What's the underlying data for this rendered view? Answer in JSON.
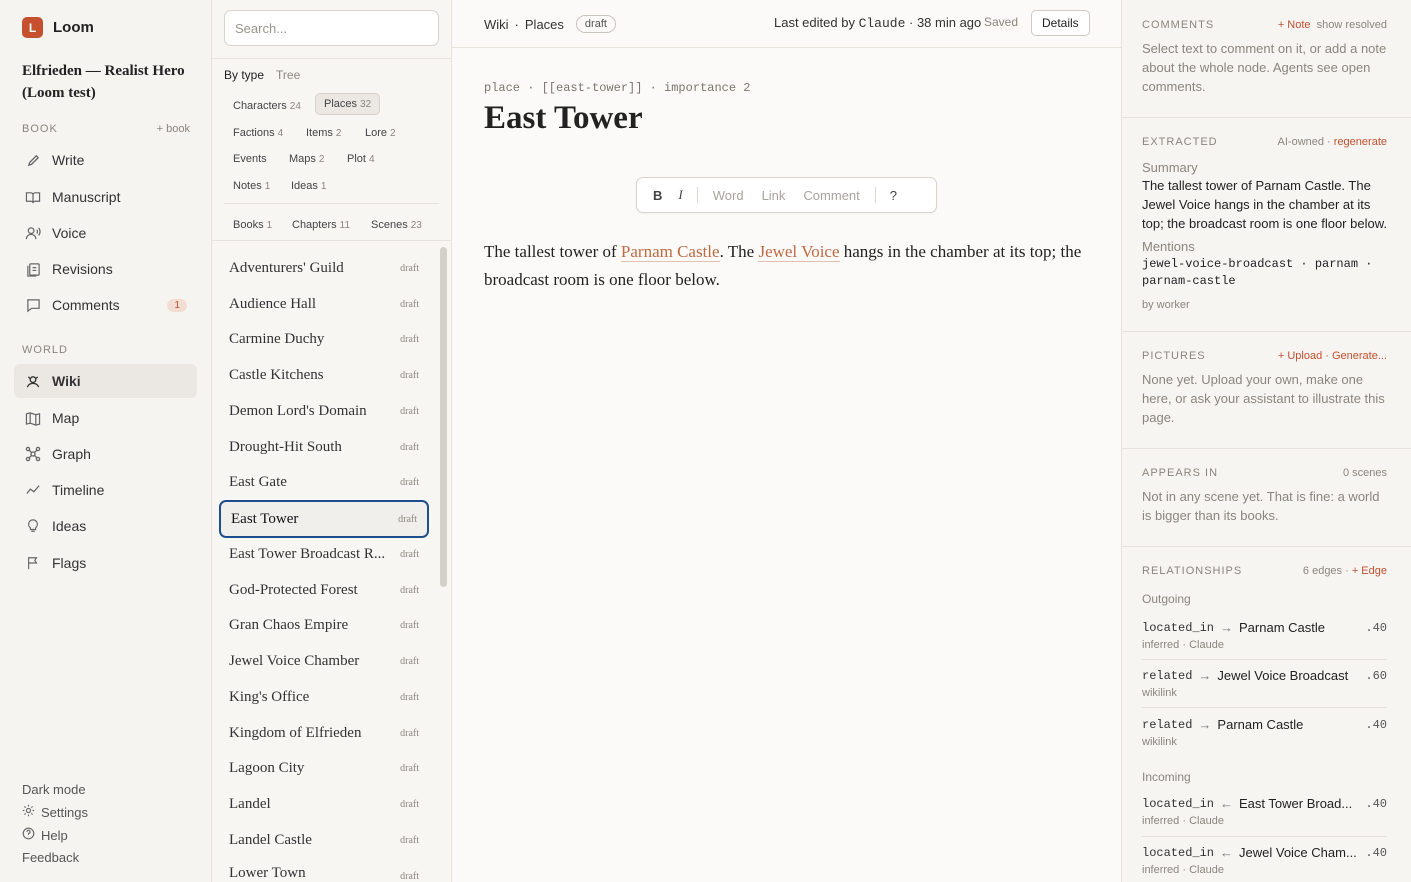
{
  "brand": {
    "logo_letter": "L",
    "name": "Loom",
    "accent": "#c4502e"
  },
  "project": {
    "title": "Elfrieden — Realist Hero (Loom test)"
  },
  "sidebar": {
    "book_heading": "BOOK",
    "book_action": "+ book",
    "book_items": [
      {
        "label": "Write",
        "icon": "pencil-icon"
      },
      {
        "label": "Manuscript",
        "icon": "book-icon"
      },
      {
        "label": "Voice",
        "icon": "voice-icon"
      },
      {
        "label": "Revisions",
        "icon": "revisions-icon"
      },
      {
        "label": "Comments",
        "icon": "comment-icon",
        "badge": "1"
      }
    ],
    "world_heading": "WORLD",
    "world_items": [
      {
        "label": "Wiki",
        "icon": "wiki-icon",
        "active": true
      },
      {
        "label": "Map",
        "icon": "map-icon"
      },
      {
        "label": "Graph",
        "icon": "graph-icon"
      },
      {
        "label": "Timeline",
        "icon": "timeline-icon"
      },
      {
        "label": "Ideas",
        "icon": "lightbulb-icon"
      },
      {
        "label": "Flags",
        "icon": "flag-icon"
      }
    ],
    "dark_mode": "Dark mode",
    "settings": "Settings",
    "help": "Help",
    "feedback": "Feedback"
  },
  "list": {
    "search_placeholder": "Search...",
    "view_by_type": "By type",
    "view_tree": "Tree",
    "type_chips": [
      {
        "label": "Characters",
        "count": "24"
      },
      {
        "label": "Places",
        "count": "32",
        "selected": true
      },
      {
        "label": "Factions",
        "count": "4"
      },
      {
        "label": "Items",
        "count": "2"
      },
      {
        "label": "Lore",
        "count": "2"
      },
      {
        "label": "Events",
        "count": ""
      },
      {
        "label": "Maps",
        "count": "2"
      },
      {
        "label": "Plot",
        "count": "4"
      },
      {
        "label": "Notes",
        "count": "1"
      },
      {
        "label": "Ideas",
        "count": "1"
      }
    ],
    "book_chips": [
      {
        "label": "Books",
        "count": "1"
      },
      {
        "label": "Chapters",
        "count": "11"
      },
      {
        "label": "Scenes",
        "count": "23"
      }
    ],
    "rows": [
      {
        "name": "Adventurers' Guild",
        "status": "draft"
      },
      {
        "name": "Audience Hall",
        "status": "draft"
      },
      {
        "name": "Carmine Duchy",
        "status": "draft"
      },
      {
        "name": "Castle Kitchens",
        "status": "draft"
      },
      {
        "name": "Demon Lord's Domain",
        "status": "draft"
      },
      {
        "name": "Drought-Hit South",
        "status": "draft"
      },
      {
        "name": "East Gate",
        "status": "draft"
      },
      {
        "name": "East Tower",
        "status": "draft",
        "selected": true
      },
      {
        "name": "East Tower Broadcast R...",
        "status": "draft"
      },
      {
        "name": "God-Protected Forest",
        "status": "draft"
      },
      {
        "name": "Gran Chaos Empire",
        "status": "draft"
      },
      {
        "name": "Jewel Voice Chamber",
        "status": "draft"
      },
      {
        "name": "King's Office",
        "status": "draft"
      },
      {
        "name": "Kingdom of Elfrieden",
        "status": "draft"
      },
      {
        "name": "Lagoon City",
        "status": "draft"
      },
      {
        "name": "Landel",
        "status": "draft"
      },
      {
        "name": "Landel Castle",
        "status": "draft"
      },
      {
        "name": "Lower Town",
        "status": "draft"
      }
    ]
  },
  "main": {
    "breadcrumb": [
      "Wiki",
      "Places"
    ],
    "status_pill": "draft",
    "edited_prefix": "Last edited by ",
    "edited_by": "Claude",
    "edited_time": "38 min ago",
    "saved": "Saved",
    "details_button": "Details",
    "meta_line": "place · [[east-tower]] · importance 2",
    "title": "East Tower",
    "toolbar": {
      "bold": "B",
      "italic": "I",
      "word": "Word",
      "link": "Link",
      "comment": "Comment",
      "help": "?"
    },
    "body": {
      "t1": "The tallest tower of ",
      "link1": "Parnam Castle",
      "t2": ". The ",
      "link2": "Jewel Voice",
      "t3": " hangs in the chamber at its top; the broadcast room is one floor below."
    }
  },
  "right": {
    "comments": {
      "heading": "COMMENTS",
      "action": "+ Note",
      "action2": "show resolved",
      "text": "Select text to comment on it, or add a note about the whole node. Agents see open comments."
    },
    "extracted": {
      "heading": "EXTRACTED",
      "owner": "AI-owned · ",
      "action": "regenerate",
      "summary_label": "Summary",
      "summary": "The tallest tower of Parnam Castle. The Jewel Voice hangs in the chamber at its top; the broadcast room is one floor below.",
      "mentions_label": "Mentions",
      "mentions": "jewel-voice-broadcast · parnam · parnam-castle",
      "by": "by worker"
    },
    "pictures": {
      "heading": "PICTURES",
      "action": "+ Upload · Generate...",
      "text": "None yet. Upload your own, make one here, or ask your assistant to illustrate this page."
    },
    "appears": {
      "heading": "APPEARS IN",
      "count": "0 scenes",
      "text": "Not in any scene yet. That is fine: a world is bigger than its books."
    },
    "relationships": {
      "heading": "RELATIONSHIPS",
      "count": "6 edges · ",
      "action": "+ Edge",
      "outgoing_label": "Outgoing",
      "incoming_label": "Incoming",
      "outgoing": [
        {
          "rel": "located_in",
          "arrow": "→",
          "target": "Parnam Castle",
          "weight": ".40",
          "source": "inferred · Claude"
        },
        {
          "rel": "related",
          "arrow": "→",
          "target": "Jewel Voice Broadcast",
          "weight": ".60",
          "source": "wikilink"
        },
        {
          "rel": "related",
          "arrow": "→",
          "target": "Parnam Castle",
          "weight": ".40",
          "source": "wikilink"
        }
      ],
      "incoming": [
        {
          "rel": "located_in",
          "arrow": "←",
          "target": "East Tower Broad...",
          "weight": ".40",
          "source": "inferred · Claude"
        },
        {
          "rel": "located_in",
          "arrow": "←",
          "target": "Jewel Voice Cham...",
          "weight": ".40",
          "source": "inferred · Claude"
        }
      ]
    }
  }
}
